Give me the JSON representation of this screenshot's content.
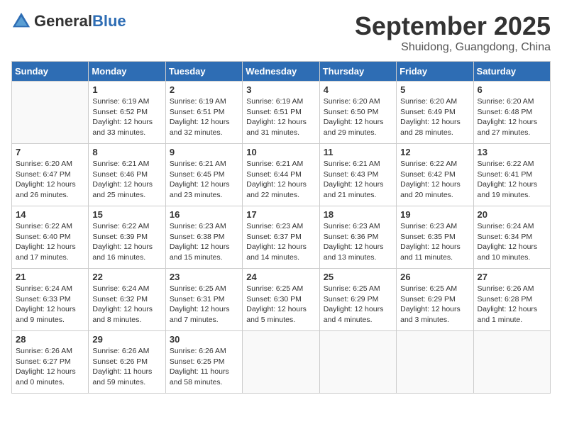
{
  "logo": {
    "general": "General",
    "blue": "Blue"
  },
  "title": {
    "month": "September 2025",
    "location": "Shuidong, Guangdong, China"
  },
  "weekdays": [
    "Sunday",
    "Monday",
    "Tuesday",
    "Wednesday",
    "Thursday",
    "Friday",
    "Saturday"
  ],
  "weeks": [
    [
      {
        "day": "",
        "info": ""
      },
      {
        "day": "1",
        "info": "Sunrise: 6:19 AM\nSunset: 6:52 PM\nDaylight: 12 hours\nand 33 minutes."
      },
      {
        "day": "2",
        "info": "Sunrise: 6:19 AM\nSunset: 6:51 PM\nDaylight: 12 hours\nand 32 minutes."
      },
      {
        "day": "3",
        "info": "Sunrise: 6:19 AM\nSunset: 6:51 PM\nDaylight: 12 hours\nand 31 minutes."
      },
      {
        "day": "4",
        "info": "Sunrise: 6:20 AM\nSunset: 6:50 PM\nDaylight: 12 hours\nand 29 minutes."
      },
      {
        "day": "5",
        "info": "Sunrise: 6:20 AM\nSunset: 6:49 PM\nDaylight: 12 hours\nand 28 minutes."
      },
      {
        "day": "6",
        "info": "Sunrise: 6:20 AM\nSunset: 6:48 PM\nDaylight: 12 hours\nand 27 minutes."
      }
    ],
    [
      {
        "day": "7",
        "info": "Sunrise: 6:20 AM\nSunset: 6:47 PM\nDaylight: 12 hours\nand 26 minutes."
      },
      {
        "day": "8",
        "info": "Sunrise: 6:21 AM\nSunset: 6:46 PM\nDaylight: 12 hours\nand 25 minutes."
      },
      {
        "day": "9",
        "info": "Sunrise: 6:21 AM\nSunset: 6:45 PM\nDaylight: 12 hours\nand 23 minutes."
      },
      {
        "day": "10",
        "info": "Sunrise: 6:21 AM\nSunset: 6:44 PM\nDaylight: 12 hours\nand 22 minutes."
      },
      {
        "day": "11",
        "info": "Sunrise: 6:21 AM\nSunset: 6:43 PM\nDaylight: 12 hours\nand 21 minutes."
      },
      {
        "day": "12",
        "info": "Sunrise: 6:22 AM\nSunset: 6:42 PM\nDaylight: 12 hours\nand 20 minutes."
      },
      {
        "day": "13",
        "info": "Sunrise: 6:22 AM\nSunset: 6:41 PM\nDaylight: 12 hours\nand 19 minutes."
      }
    ],
    [
      {
        "day": "14",
        "info": "Sunrise: 6:22 AM\nSunset: 6:40 PM\nDaylight: 12 hours\nand 17 minutes."
      },
      {
        "day": "15",
        "info": "Sunrise: 6:22 AM\nSunset: 6:39 PM\nDaylight: 12 hours\nand 16 minutes."
      },
      {
        "day": "16",
        "info": "Sunrise: 6:23 AM\nSunset: 6:38 PM\nDaylight: 12 hours\nand 15 minutes."
      },
      {
        "day": "17",
        "info": "Sunrise: 6:23 AM\nSunset: 6:37 PM\nDaylight: 12 hours\nand 14 minutes."
      },
      {
        "day": "18",
        "info": "Sunrise: 6:23 AM\nSunset: 6:36 PM\nDaylight: 12 hours\nand 13 minutes."
      },
      {
        "day": "19",
        "info": "Sunrise: 6:23 AM\nSunset: 6:35 PM\nDaylight: 12 hours\nand 11 minutes."
      },
      {
        "day": "20",
        "info": "Sunrise: 6:24 AM\nSunset: 6:34 PM\nDaylight: 12 hours\nand 10 minutes."
      }
    ],
    [
      {
        "day": "21",
        "info": "Sunrise: 6:24 AM\nSunset: 6:33 PM\nDaylight: 12 hours\nand 9 minutes."
      },
      {
        "day": "22",
        "info": "Sunrise: 6:24 AM\nSunset: 6:32 PM\nDaylight: 12 hours\nand 8 minutes."
      },
      {
        "day": "23",
        "info": "Sunrise: 6:25 AM\nSunset: 6:31 PM\nDaylight: 12 hours\nand 7 minutes."
      },
      {
        "day": "24",
        "info": "Sunrise: 6:25 AM\nSunset: 6:30 PM\nDaylight: 12 hours\nand 5 minutes."
      },
      {
        "day": "25",
        "info": "Sunrise: 6:25 AM\nSunset: 6:29 PM\nDaylight: 12 hours\nand 4 minutes."
      },
      {
        "day": "26",
        "info": "Sunrise: 6:25 AM\nSunset: 6:29 PM\nDaylight: 12 hours\nand 3 minutes."
      },
      {
        "day": "27",
        "info": "Sunrise: 6:26 AM\nSunset: 6:28 PM\nDaylight: 12 hours\nand 1 minute."
      }
    ],
    [
      {
        "day": "28",
        "info": "Sunrise: 6:26 AM\nSunset: 6:27 PM\nDaylight: 12 hours\nand 0 minutes."
      },
      {
        "day": "29",
        "info": "Sunrise: 6:26 AM\nSunset: 6:26 PM\nDaylight: 11 hours\nand 59 minutes."
      },
      {
        "day": "30",
        "info": "Sunrise: 6:26 AM\nSunset: 6:25 PM\nDaylight: 11 hours\nand 58 minutes."
      },
      {
        "day": "",
        "info": ""
      },
      {
        "day": "",
        "info": ""
      },
      {
        "day": "",
        "info": ""
      },
      {
        "day": "",
        "info": ""
      }
    ]
  ]
}
